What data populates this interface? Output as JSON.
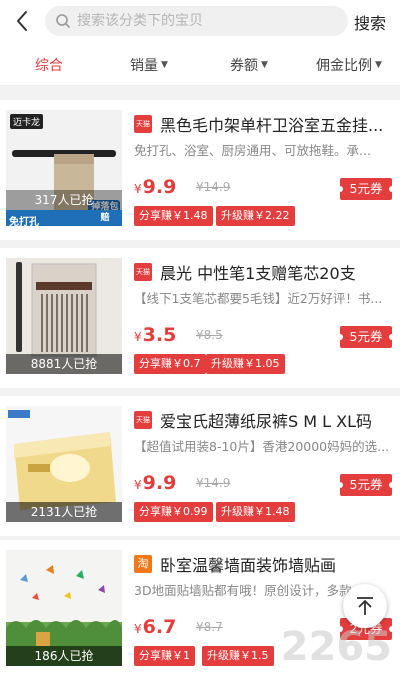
{
  "header": {
    "search_placeholder": "搜索该分类下的宝贝",
    "search_button": "搜索"
  },
  "tabs": [
    {
      "label": "综合",
      "active": true
    },
    {
      "label": "销量"
    },
    {
      "label": "券额"
    },
    {
      "label": "佣金比例"
    }
  ],
  "products": [
    {
      "shop_tag": "天猫",
      "title": "黑色毛巾架单杆卫浴室五金挂...",
      "desc": "免打孔、浴室、厨房通用、可放拖鞋。承...",
      "price_symbol": "¥",
      "price": "9.9",
      "original_price": "¥14.9",
      "coupon": "5元券",
      "share_earn": "分享赚￥1.48",
      "upgrade_earn": "升级赚￥2.22",
      "sold": "317人已抢",
      "brand_logo": "迈卡龙",
      "badge_1": "免打孔",
      "badge_2": "掉落包赔"
    },
    {
      "shop_tag": "天猫",
      "title": "晨光 中性笔1支赠笔芯20支",
      "desc": "【线下1支笔芯都要5毛钱】近2万好评！书...",
      "price_symbol": "¥",
      "price": "3.5",
      "original_price": "¥8.5",
      "coupon": "5元券",
      "share_earn": "分享赚￥0.7",
      "upgrade_earn": "升级赚￥1.05",
      "sold": "8881人已抢"
    },
    {
      "shop_tag": "天猫",
      "title": "爱宝氏超薄纸尿裤S M L XL码",
      "desc": "【超值试用装8-10片】香港20000妈妈的选...",
      "price_symbol": "¥",
      "price": "9.9",
      "original_price": "¥14.9",
      "coupon": "5元券",
      "share_earn": "分享赚￥0.99",
      "upgrade_earn": "升级赚￥1.48",
      "sold": "2131人已抢"
    },
    {
      "shop_tag": "淘",
      "title": "卧室温馨墙面装饰墙贴画",
      "desc": "3D地面贴墙贴都有哦！原创设计，多款...",
      "price_symbol": "¥",
      "price": "6.7",
      "original_price": "¥8.7",
      "coupon": "2元券",
      "share_earn": "分享赚￥1",
      "upgrade_earn": "升级赚￥1.5",
      "sold": "186人已抢"
    }
  ],
  "watermark": "2265",
  "colors": {
    "accent": "#e43d3d",
    "tao": "#f07818"
  },
  "icons": {
    "back": "back-arrow-icon",
    "search": "search-icon",
    "top": "back-to-top-icon"
  }
}
